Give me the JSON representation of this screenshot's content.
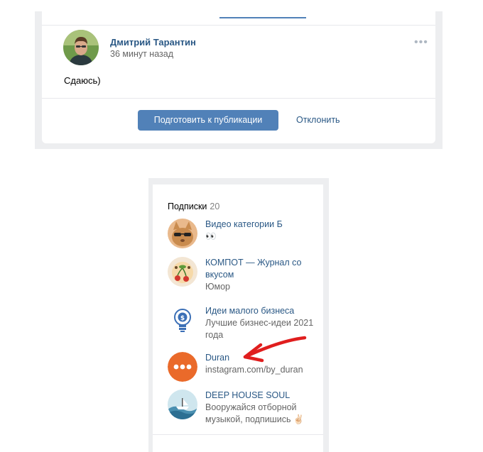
{
  "post": {
    "author_name": "Дмитрий Тарантин",
    "time": "36 минут назад",
    "more_icon": "•••",
    "text": "Сдаюсь)",
    "publish_label": "Подготовить к публикации",
    "reject_label": "Отклонить",
    "accent_color": "#5181b8"
  },
  "subscriptions": {
    "title": "Подписки",
    "count": "20",
    "items": [
      {
        "name": "Видео категории Б",
        "desc": "👀",
        "avatar_icon": "cat-sunglasses-icon"
      },
      {
        "name": "КОМПОТ — Журнал со вкусом",
        "desc": "Юмор",
        "avatar_icon": "cherry-face-icon"
      },
      {
        "name": "Идеи малого бизнеса",
        "desc": "Лучшие бизнес-идеи 2021 года",
        "avatar_icon": "lightbulb-dollar-icon"
      },
      {
        "name": "Duran",
        "desc": "instagram.com/by_duran",
        "avatar_icon": "three-dots-orange-icon"
      },
      {
        "name": "DEEP HOUSE SOUL",
        "desc": "Вооружайся отборной музыкой, подпишись ✌🏻",
        "avatar_icon": "ship-waves-icon"
      }
    ]
  }
}
